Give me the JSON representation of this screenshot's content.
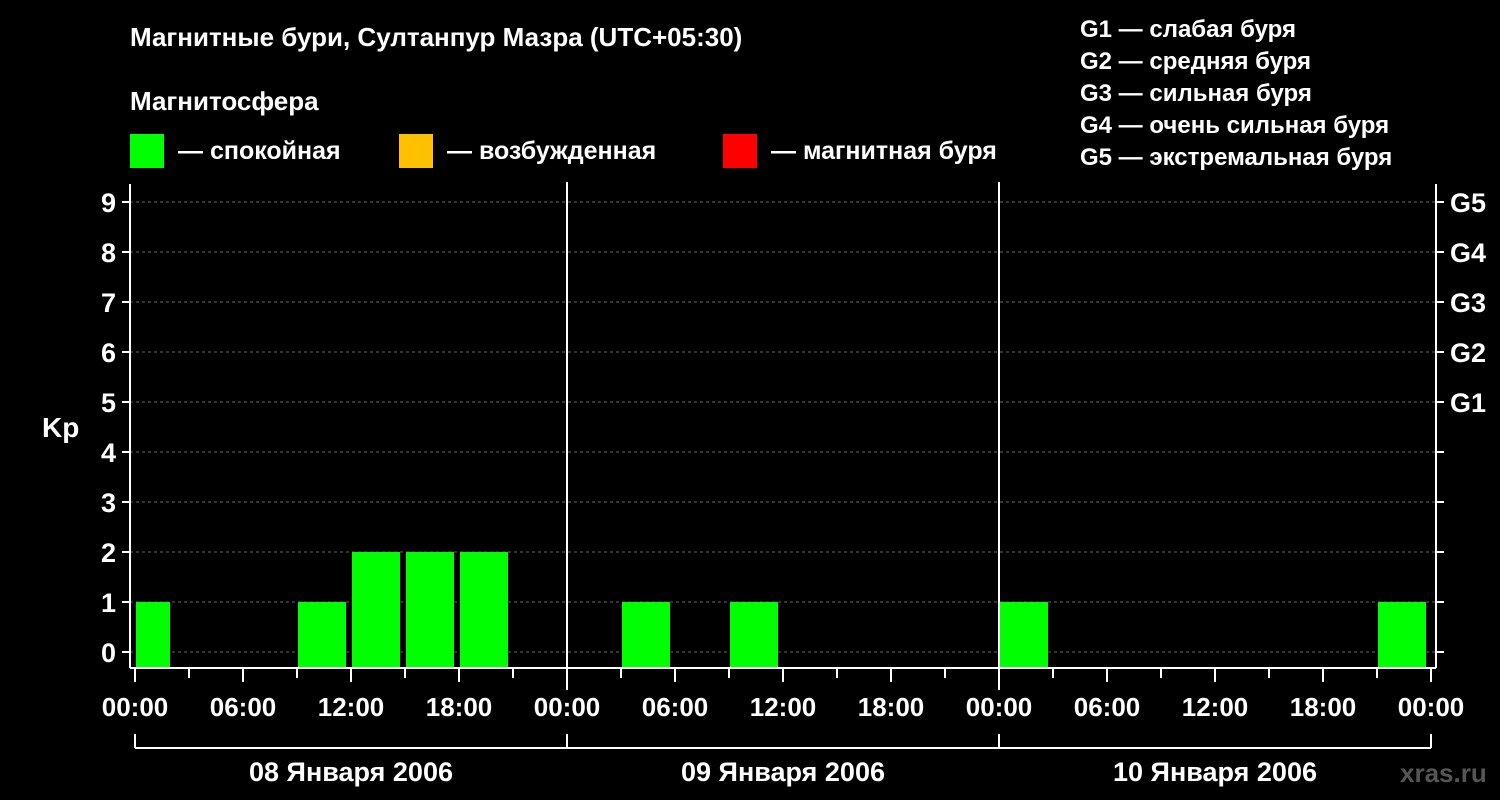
{
  "title": "Магнитные бури, Султанпур Мазра (UTC+05:30)",
  "subtitle": "Магнитосфера",
  "legend": [
    {
      "color": "#00ff00",
      "label": "— спокойная"
    },
    {
      "color": "#ffc000",
      "label": "— возбужденная"
    },
    {
      "color": "#ff0000",
      "label": "— магнитная буря"
    }
  ],
  "g_legend": [
    "G1 — слабая буря",
    "G2 — средняя буря",
    "G3 — сильная буря",
    "G4 — очень сильная буря",
    "G5 — экстремальная буря"
  ],
  "watermark": "xras.ru",
  "chart_data": {
    "type": "bar",
    "ylabel": "Kp",
    "ylim": [
      0,
      9
    ],
    "y_ticks": [
      "0",
      "1",
      "2",
      "3",
      "4",
      "5",
      "6",
      "7",
      "8",
      "9"
    ],
    "right_labels": [
      {
        "kp": 5,
        "label": "G1"
      },
      {
        "kp": 6,
        "label": "G2"
      },
      {
        "kp": 7,
        "label": "G3"
      },
      {
        "kp": 8,
        "label": "G4"
      },
      {
        "kp": 9,
        "label": "G5"
      }
    ],
    "x_tick_labels": [
      "00:00",
      "06:00",
      "12:00",
      "18:00",
      "00:00",
      "06:00",
      "12:00",
      "18:00",
      "00:00",
      "06:00",
      "12:00",
      "18:00",
      "00:00"
    ],
    "days": [
      "08 Января 2006",
      "09 Января 2006",
      "10 Января 2006"
    ],
    "grid": true,
    "interval_hours": 3,
    "bars": [
      {
        "start": "2006-01-08 00:00",
        "kp": 1,
        "color": "#00ff00"
      },
      {
        "start": "2006-01-08 03:00",
        "kp": 0,
        "color": "#00ff00"
      },
      {
        "start": "2006-01-08 06:00",
        "kp": 0,
        "color": "#00ff00"
      },
      {
        "start": "2006-01-08 09:00",
        "kp": 1,
        "color": "#00ff00"
      },
      {
        "start": "2006-01-08 12:00",
        "kp": 2,
        "color": "#00ff00"
      },
      {
        "start": "2006-01-08 15:00",
        "kp": 2,
        "color": "#00ff00"
      },
      {
        "start": "2006-01-08 18:00",
        "kp": 2,
        "color": "#00ff00"
      },
      {
        "start": "2006-01-08 21:00",
        "kp": 0,
        "color": "#00ff00"
      },
      {
        "start": "2006-01-09 00:00",
        "kp": 0,
        "color": "#00ff00"
      },
      {
        "start": "2006-01-09 03:00",
        "kp": 1,
        "color": "#00ff00"
      },
      {
        "start": "2006-01-09 06:00",
        "kp": 0,
        "color": "#00ff00"
      },
      {
        "start": "2006-01-09 09:00",
        "kp": 1,
        "color": "#00ff00"
      },
      {
        "start": "2006-01-09 12:00",
        "kp": 0,
        "color": "#00ff00"
      },
      {
        "start": "2006-01-09 15:00",
        "kp": 0,
        "color": "#00ff00"
      },
      {
        "start": "2006-01-09 18:00",
        "kp": 0,
        "color": "#00ff00"
      },
      {
        "start": "2006-01-09 21:00",
        "kp": 0,
        "color": "#00ff00"
      },
      {
        "start": "2006-01-10 00:00",
        "kp": 1,
        "color": "#00ff00"
      },
      {
        "start": "2006-01-10 03:00",
        "kp": 0,
        "color": "#00ff00"
      },
      {
        "start": "2006-01-10 06:00",
        "kp": 0,
        "color": "#00ff00"
      },
      {
        "start": "2006-01-10 09:00",
        "kp": 0,
        "color": "#00ff00"
      },
      {
        "start": "2006-01-10 12:00",
        "kp": 0,
        "color": "#00ff00"
      },
      {
        "start": "2006-01-10 15:00",
        "kp": 0,
        "color": "#00ff00"
      },
      {
        "start": "2006-01-10 18:00",
        "kp": 0,
        "color": "#00ff00"
      },
      {
        "start": "2006-01-10 21:00",
        "kp": 1,
        "color": "#00ff00"
      }
    ]
  }
}
